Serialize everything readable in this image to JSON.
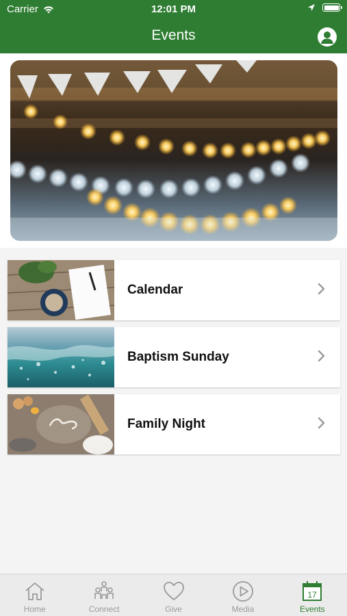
{
  "status_bar": {
    "carrier": "Carrier",
    "time": "12:01 PM"
  },
  "nav": {
    "title": "Events",
    "profile_icon": "person-icon"
  },
  "events": [
    {
      "label": "Calendar",
      "icon": "chevron-right-icon"
    },
    {
      "label": "Baptism Sunday",
      "icon": "chevron-right-icon"
    },
    {
      "label": "Family Night",
      "icon": "chevron-right-icon"
    }
  ],
  "tab_bar": {
    "items": [
      {
        "label": "Home",
        "icon": "house-icon"
      },
      {
        "label": "Connect",
        "icon": "people-icon"
      },
      {
        "label": "Give",
        "icon": "heart-icon"
      },
      {
        "label": "Media",
        "icon": "play-icon"
      },
      {
        "label": "Events",
        "icon": "calendar-icon",
        "badge": "17"
      }
    ],
    "active": "Events"
  },
  "colors": {
    "brand_green": "#2e7d32",
    "inactive_gray": "#9a9a9a"
  }
}
